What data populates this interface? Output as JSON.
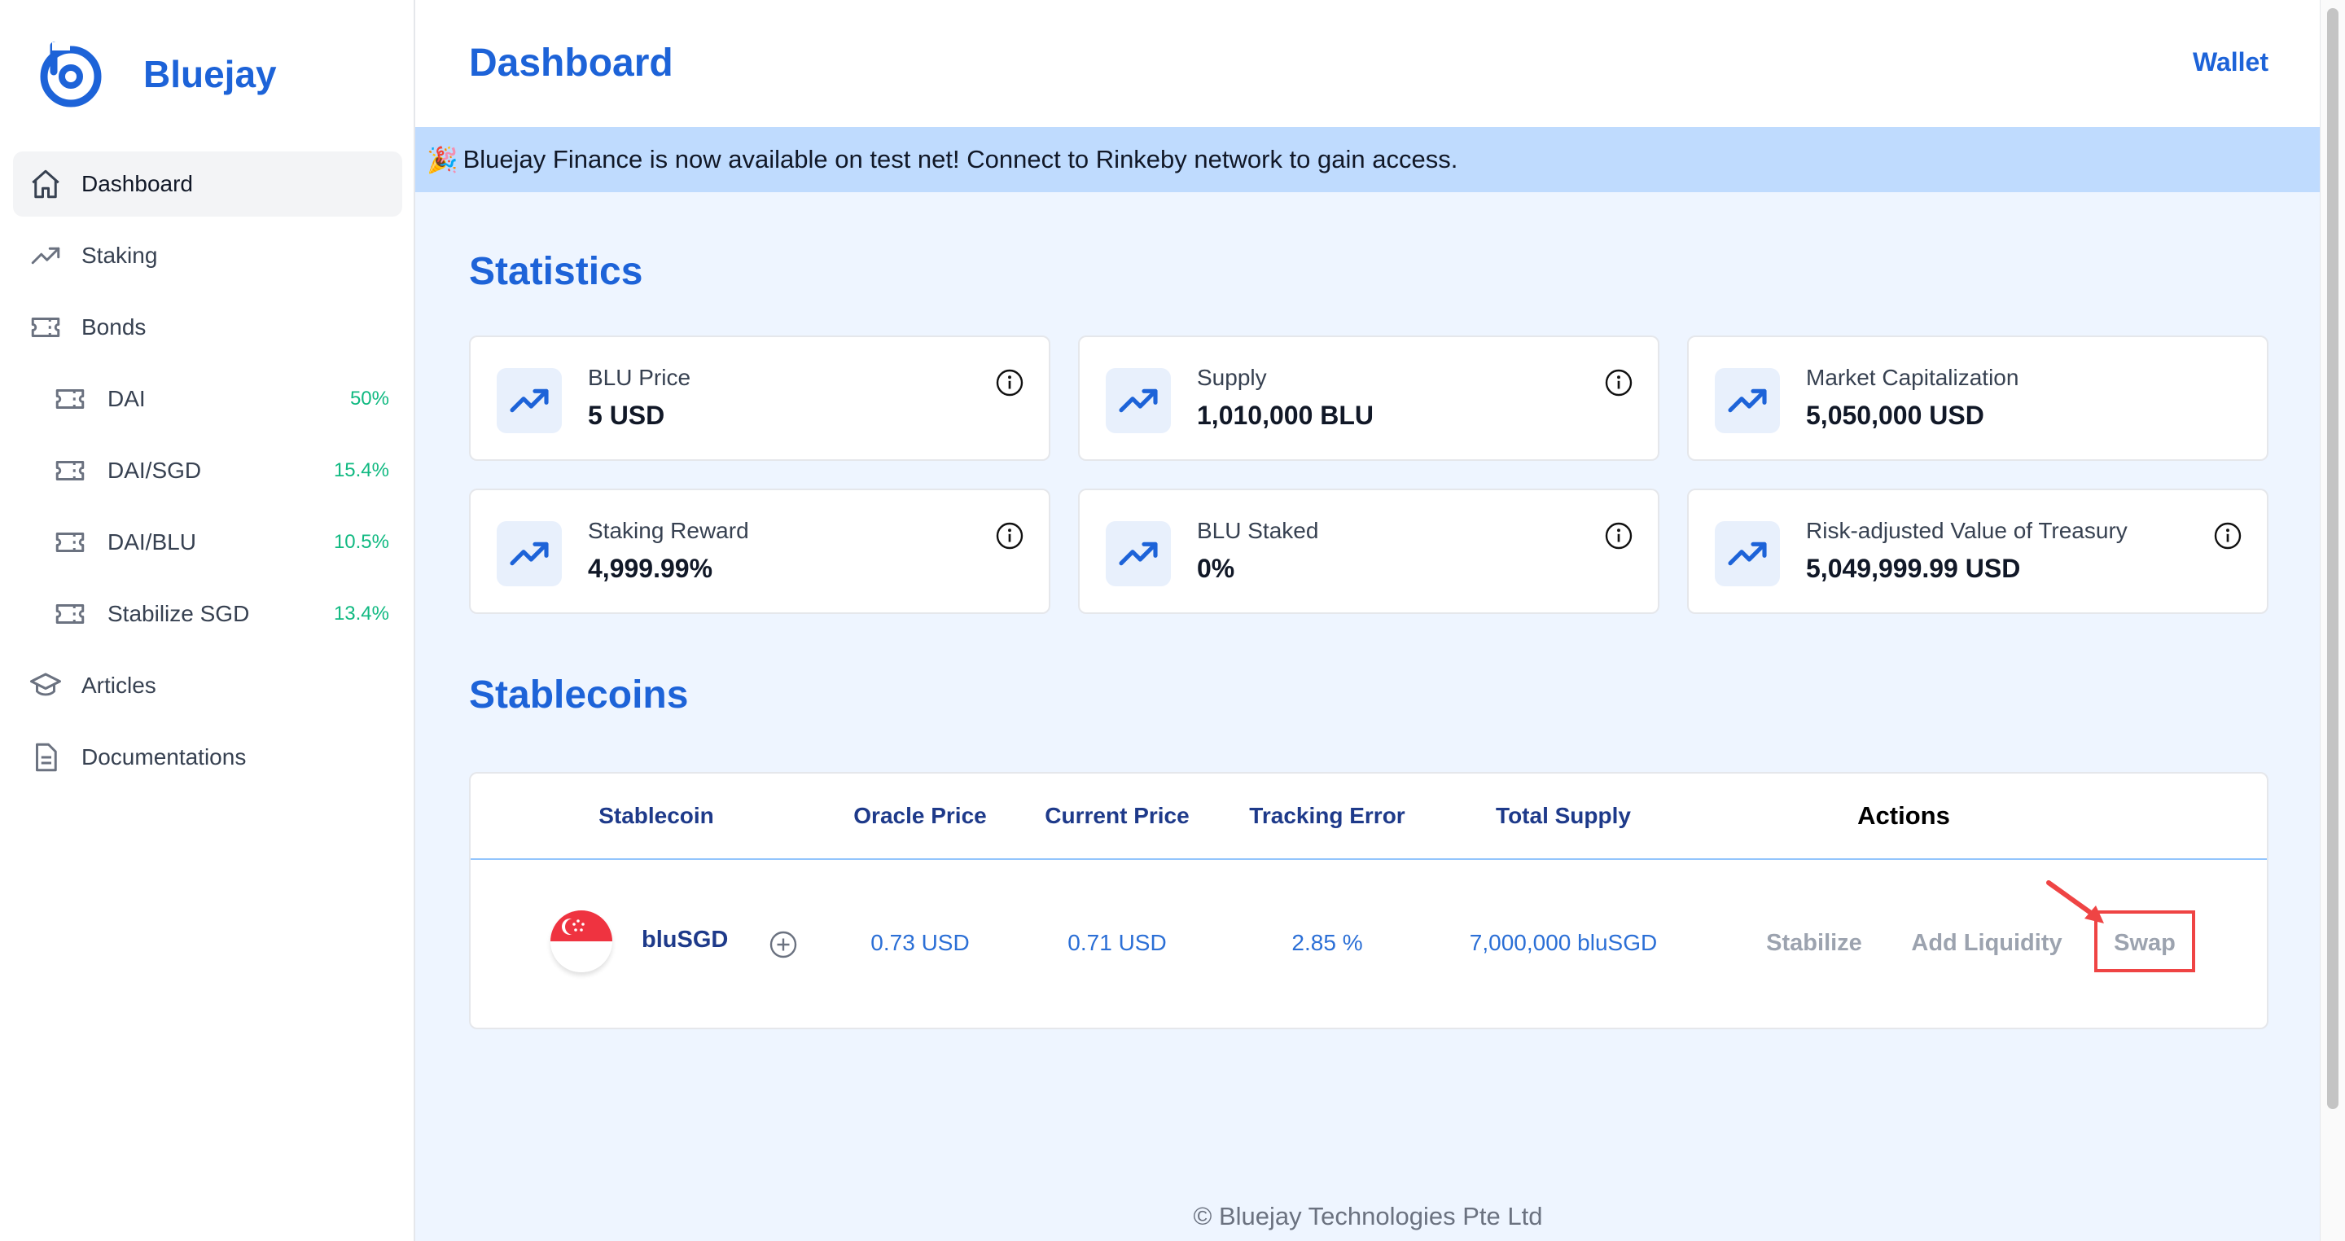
{
  "app": {
    "name": "Bluejay"
  },
  "sidebar": {
    "items": [
      {
        "label": "Dashboard",
        "icon": "home-icon",
        "active": true
      },
      {
        "label": "Staking",
        "icon": "trending-up-icon"
      },
      {
        "label": "Bonds",
        "icon": "ticket-icon"
      },
      {
        "label": "DAI",
        "icon": "ticket-icon",
        "pct": "50%"
      },
      {
        "label": "DAI/SGD",
        "icon": "ticket-icon",
        "pct": "15.4%"
      },
      {
        "label": "DAI/BLU",
        "icon": "ticket-icon",
        "pct": "10.5%"
      },
      {
        "label": "Stabilize SGD",
        "icon": "ticket-icon",
        "pct": "13.4%"
      },
      {
        "label": "Articles",
        "icon": "academic-cap-icon"
      },
      {
        "label": "Documentations",
        "icon": "document-icon"
      }
    ]
  },
  "header": {
    "title": "Dashboard",
    "wallet_label": "Wallet"
  },
  "banner": {
    "emoji": "🎉",
    "text": "Bluejay Finance is now available on test net! Connect to Rinkeby network to gain access."
  },
  "statistics": {
    "title": "Statistics",
    "cards": [
      {
        "label": "BLU Price",
        "value": "5 USD",
        "info": true
      },
      {
        "label": "Supply",
        "value": "1,010,000 BLU",
        "info": true
      },
      {
        "label": "Market Capitalization",
        "value": "5,050,000 USD",
        "info": false
      },
      {
        "label": "Staking Reward",
        "value": "4,999.99%",
        "info": true
      },
      {
        "label": "BLU Staked",
        "value": "0%",
        "info": true
      },
      {
        "label": "Risk-adjusted Value of Treasury",
        "value": "5,049,999.99 USD",
        "info": true
      }
    ]
  },
  "stablecoins": {
    "title": "Stablecoins",
    "headers": {
      "stablecoin": "Stablecoin",
      "oracle_price": "Oracle Price",
      "current_price": "Current Price",
      "tracking_error": "Tracking Error",
      "total_supply": "Total Supply",
      "actions": "Actions"
    },
    "rows": [
      {
        "name": "bluSGD",
        "oracle_price": "0.73 USD",
        "current_price": "0.71 USD",
        "tracking_error": "2.85 %",
        "total_supply": "7,000,000 bluSGD",
        "actions": {
          "stabilize": "Stabilize",
          "add_liquidity": "Add Liquidity",
          "swap": "Swap"
        }
      }
    ]
  },
  "footer": {
    "text": "© Bluejay Technologies Pte Ltd"
  },
  "colors": {
    "brand": "#1d63d8",
    "banner": "#bfdbfe",
    "positive": "#10b981",
    "highlight": "#ef4444"
  }
}
